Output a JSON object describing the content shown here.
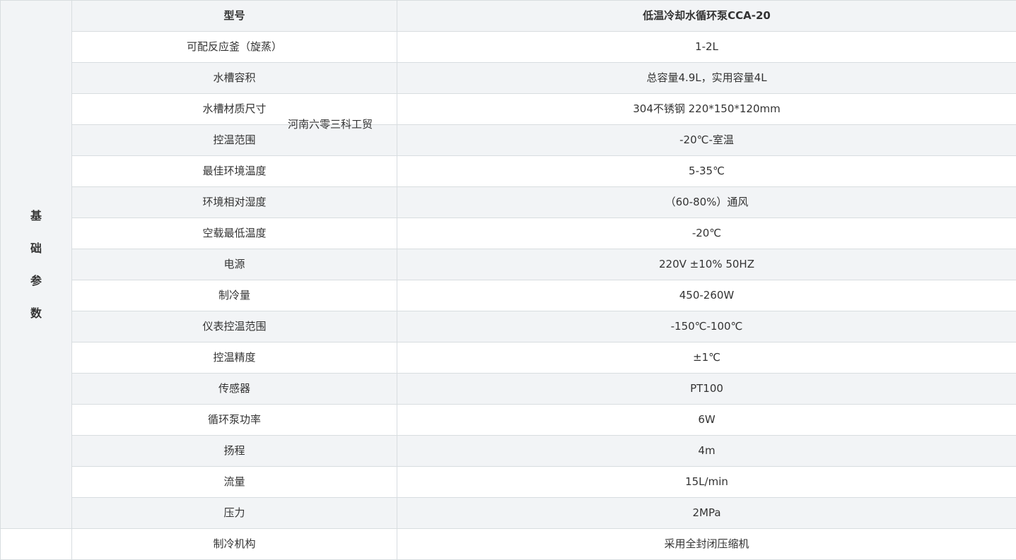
{
  "watermark": "河南六零三科工贸",
  "category": "基础参数",
  "header": {
    "label": "型号",
    "value": "低温冷却水循环泵CCA-20"
  },
  "rows": [
    {
      "label": "可配反应釜（旋蒸）",
      "value": "1-2L"
    },
    {
      "label": "水槽容积",
      "value": "总容量4.9L，实用容量4L"
    },
    {
      "label": "水槽材质尺寸",
      "value": "304不锈钢  220*150*120mm"
    },
    {
      "label": "控温范围",
      "value": "-20℃-室温"
    },
    {
      "label": "最佳环境温度",
      "value": "5-35℃"
    },
    {
      "label": "环境相对湿度",
      "value": "（60-80%）通风"
    },
    {
      "label": "空载最低温度",
      "value": "-20℃"
    },
    {
      "label": "电源",
      "value": "220V ±10%  50HZ"
    },
    {
      "label": "制冷量",
      "value": "450-260W"
    },
    {
      "label": "仪表控温范围",
      "value": "-150℃-100℃"
    },
    {
      "label": "控温精度",
      "value": "±1℃"
    },
    {
      "label": "传感器",
      "value": "PT100"
    },
    {
      "label": "循环泵功率",
      "value": "6W"
    },
    {
      "label": "扬程",
      "value": "4m"
    },
    {
      "label": "流量",
      "value": "15L/min"
    },
    {
      "label": "压力",
      "value": "2MPa"
    }
  ],
  "extra_row": {
    "label": "制冷机构",
    "value": "采用全封闭压缩机"
  }
}
